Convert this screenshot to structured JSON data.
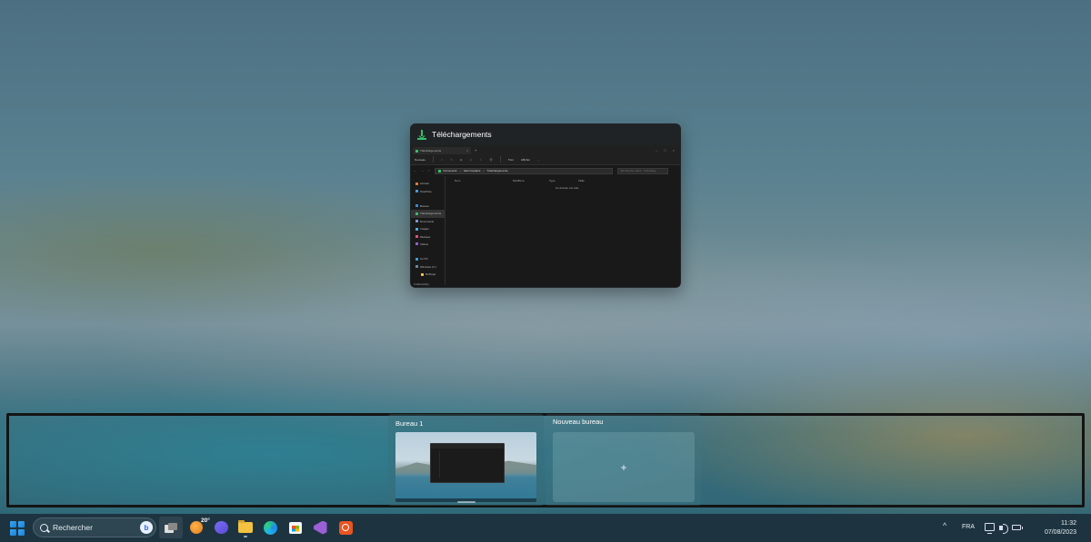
{
  "window_preview": {
    "title": "Téléchargements",
    "explorer": {
      "tab_label": "Téléchargements",
      "toolbar": {
        "new_label": "Nouveau",
        "sort_label": "Trier",
        "view_label": "Afficher",
        "more_label": "···"
      },
      "breadcrumb": [
        "Documents",
        "Saint Geslaire",
        "Téléchargements"
      ],
      "search_placeholder": "Rechercher dans : Télécharg...",
      "nav_items": [
        {
          "label": "Accueil",
          "color": "#e07a3a"
        },
        {
          "label": "OneDrive",
          "color": "#4a9ad8"
        },
        {
          "label": "Bureau",
          "color": "#3a8ad8"
        },
        {
          "label": "Téléchargements",
          "color": "#35c06a"
        },
        {
          "label": "Documents",
          "color": "#7a9ad8"
        },
        {
          "label": "Images",
          "color": "#4ab0e8"
        },
        {
          "label": "Musique",
          "color": "#e0508a"
        },
        {
          "label": "Vidéos",
          "color": "#9a5ad8"
        },
        {
          "label": "Ce PC",
          "color": "#3aa0d8"
        },
        {
          "label": "Windows (C:)",
          "color": "#6a8aa8"
        },
        {
          "label": "Ruthogs",
          "color": "#f3c241"
        }
      ],
      "columns": [
        "Nom",
        "Modifié le",
        "Type",
        "Taille"
      ],
      "empty_message": "Ce dossier est vide.",
      "status": "0 élément(s)"
    }
  },
  "desktops": {
    "desktop1_label": "Bureau 1",
    "new_desktop_label": "Nouveau bureau",
    "new_desktop_plus": "+"
  },
  "taskbar": {
    "search_placeholder": "Rechercher",
    "bing_badge": "b",
    "weather_temp": "20°",
    "apps": [
      "task-view",
      "weather",
      "chat",
      "file-explorer",
      "edge",
      "store",
      "visual-studio",
      "ubuntu"
    ]
  },
  "tray": {
    "chevron": "^",
    "language": "FRA",
    "time": "11:32",
    "date": "07/08/2023"
  }
}
